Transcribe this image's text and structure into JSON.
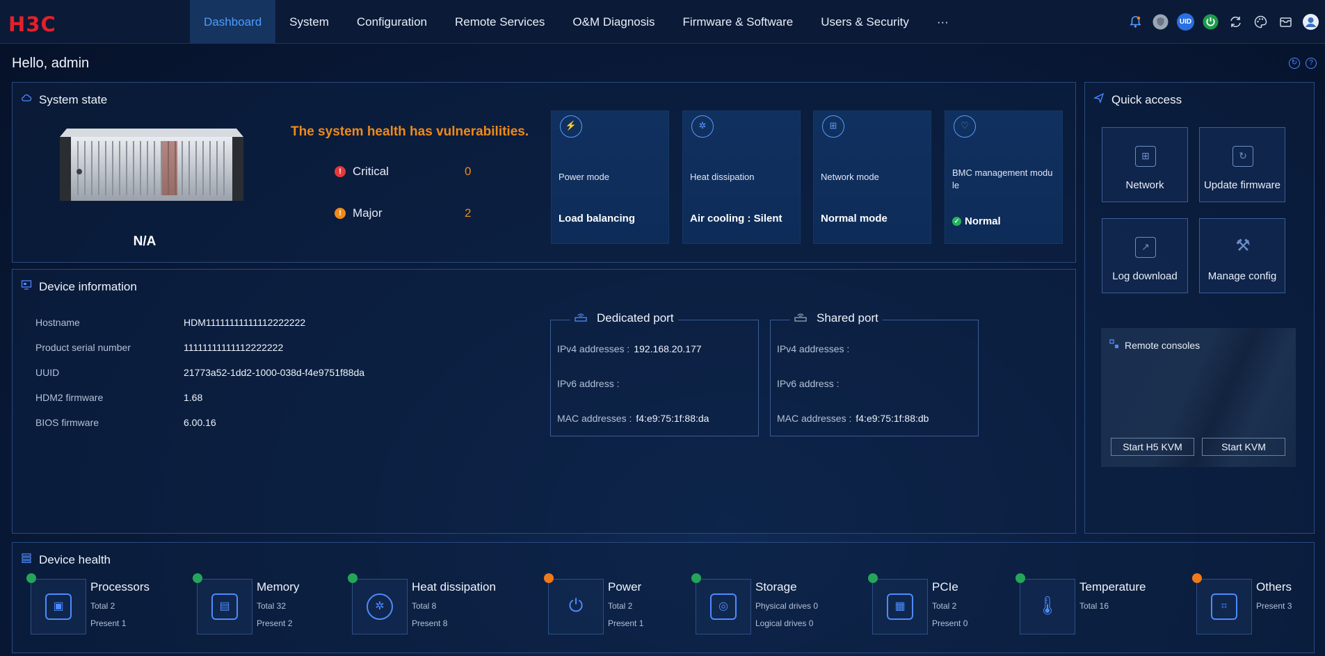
{
  "brand": {
    "logo": "H3C",
    "accent": "#4f9bff",
    "logo_color": "#e3202c"
  },
  "nav": {
    "items": [
      "Dashboard",
      "System",
      "Configuration",
      "Remote Services",
      "O&M Diagnosis",
      "Firmware & Software",
      "Users & Security",
      "···"
    ],
    "active": "Dashboard"
  },
  "topbar_icons": [
    "bell-icon",
    "shield-icon",
    "uid-icon",
    "power-icon",
    "sync-icon",
    "palette-icon",
    "mail-icon",
    "user-avatar-icon"
  ],
  "topbar_uid_label": "UID",
  "greeting": "Hello, admin",
  "system_state": {
    "title": "System state",
    "model": "N/A",
    "health_message": "The system health has vulnerabilities.",
    "critical_label": "Critical",
    "critical_value": "0",
    "major_label": "Major",
    "major_value": "2",
    "cards": [
      {
        "label": "Power mode",
        "value": "Load balancing",
        "icon": "power-mode-icon"
      },
      {
        "label": "Heat dissipation",
        "value": "Air cooling : Silent",
        "icon": "fan-icon"
      },
      {
        "label": "Network mode",
        "value": "Normal mode",
        "icon": "network-mode-icon"
      },
      {
        "label": "BMC management modu le",
        "value": "Normal",
        "icon": "heart-icon"
      }
    ]
  },
  "quick_access": {
    "title": "Quick access",
    "buttons": [
      "Network",
      "Update firmware",
      "Log download",
      "Manage config"
    ],
    "remote_consoles": {
      "title": "Remote consoles",
      "h5_kvm": "Start H5 KVM",
      "kvm": "Start KVM"
    }
  },
  "device_info": {
    "title": "Device information",
    "rows": [
      {
        "key": "Hostname",
        "value": "HDM11111111111112222222"
      },
      {
        "key": "Product serial number",
        "value": "11111111111112222222"
      },
      {
        "key": "UUID",
        "value": "21773a52-1dd2-1000-038d-f4e9751f88da"
      },
      {
        "key": "HDM2 firmware",
        "value": "1.68"
      },
      {
        "key": "BIOS firmware",
        "value": "6.00.16"
      }
    ],
    "dedicated_port": {
      "title": "Dedicated port",
      "ipv4_label": "IPv4 addresses :",
      "ipv4": "192.168.20.177",
      "ipv6_label": "IPv6 address :",
      "ipv6": "",
      "mac_label": "MAC addresses :",
      "mac": "f4:e9:75:1f:88:da"
    },
    "shared_port": {
      "title": "Shared port",
      "ipv4_label": "IPv4 addresses :",
      "ipv4": "",
      "ipv6_label": "IPv6 address :",
      "ipv6": "",
      "mac_label": "MAC addresses :",
      "mac": "f4:e9:75:1f:88:db"
    }
  },
  "device_health": {
    "title": "Device health",
    "items": [
      {
        "name": "Processors",
        "line1": "Total 2",
        "line2": "Present 1",
        "status": "green"
      },
      {
        "name": "Memory",
        "line1": "Total 32",
        "line2": "Present 2",
        "status": "green"
      },
      {
        "name": "Heat dissipation",
        "line1": "Total 8",
        "line2": "Present 8",
        "status": "green"
      },
      {
        "name": "Power",
        "line1": "Total 2",
        "line2": "Present 1",
        "status": "orange"
      },
      {
        "name": "Storage",
        "line1": "Physical drives 0",
        "line2": "Logical drives 0",
        "status": "green"
      },
      {
        "name": "PCIe",
        "line1": "Total 2",
        "line2": "Present 0",
        "status": "green"
      },
      {
        "name": "Temperature",
        "line1": "Total 16",
        "line2": "",
        "status": "green"
      },
      {
        "name": "Others",
        "line1": "Present 3",
        "line2": "",
        "status": "orange"
      }
    ],
    "status_colors": {
      "green": "#25a55a",
      "orange": "#f07a1a"
    }
  }
}
